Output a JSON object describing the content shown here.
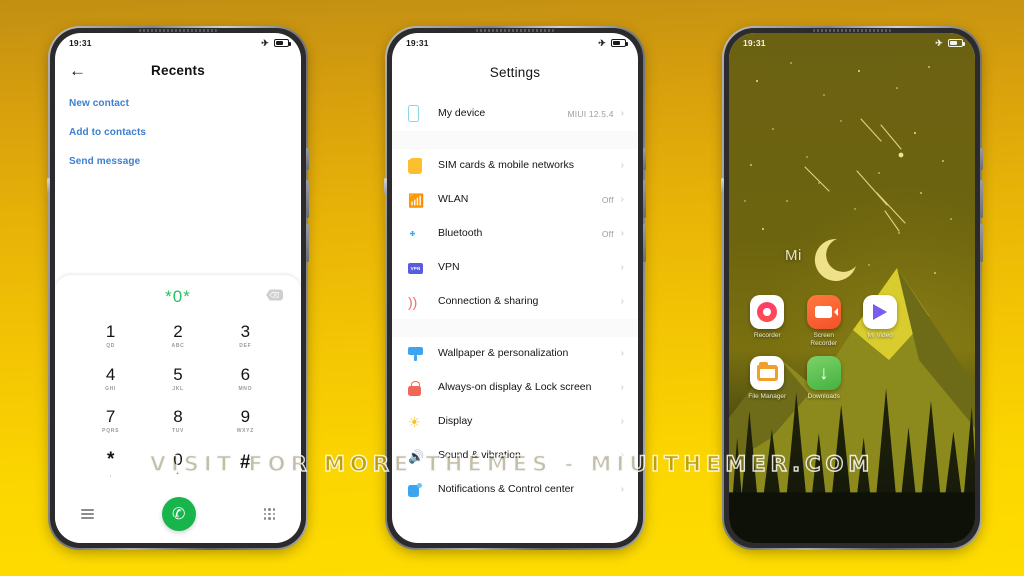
{
  "watermark": "VISIT  FOR  MORE  THEMES  -  MIUITHEMER.COM",
  "status_bar": {
    "time": "19:31",
    "airplane_icon": "airplane-mode-icon",
    "battery_icon": "battery-icon"
  },
  "phone1": {
    "header": {
      "back_icon": "back-arrow-icon",
      "title": "Recents"
    },
    "links": [
      {
        "label": "New contact"
      },
      {
        "label": "Add to contacts"
      },
      {
        "label": "Send message"
      }
    ],
    "dialer": {
      "number": "*0*",
      "backspace_icon": "backspace-icon",
      "keys": [
        {
          "num": "1",
          "sub": "QD"
        },
        {
          "num": "2",
          "sub": "ABC"
        },
        {
          "num": "3",
          "sub": "DEF"
        },
        {
          "num": "4",
          "sub": "GHI"
        },
        {
          "num": "5",
          "sub": "JKL"
        },
        {
          "num": "6",
          "sub": "MNO"
        },
        {
          "num": "7",
          "sub": "PQRS"
        },
        {
          "num": "8",
          "sub": "TUV"
        },
        {
          "num": "9",
          "sub": "WXYZ"
        },
        {
          "num": "*",
          "sub": ","
        },
        {
          "num": "0",
          "sub": "+"
        },
        {
          "num": "#",
          "sub": ""
        }
      ],
      "menu_icon": "hamburger-menu-icon",
      "call_icon": "call-icon",
      "keypad_icon": "keypad-grid-icon",
      "accent_green": "#18b44c",
      "number_color": "#28c160"
    },
    "link_color": "#3c7fd0"
  },
  "phone2": {
    "title": "Settings",
    "group_top": [
      {
        "label": "My device",
        "value": "MIUI 12.5.4",
        "icon": "device-phone-icon"
      }
    ],
    "group_network": [
      {
        "label": "SIM cards & mobile networks",
        "value": "",
        "icon": "sim-card-icon"
      },
      {
        "label": "WLAN",
        "value": "Off",
        "icon": "wifi-icon"
      },
      {
        "label": "Bluetooth",
        "value": "Off",
        "icon": "bluetooth-icon"
      },
      {
        "label": "VPN",
        "value": "",
        "icon": "vpn-icon"
      },
      {
        "label": "Connection & sharing",
        "value": "",
        "icon": "connection-sharing-icon"
      }
    ],
    "group_system": [
      {
        "label": "Wallpaper & personalization",
        "value": "",
        "icon": "wallpaper-icon"
      },
      {
        "label": "Always-on display & Lock screen",
        "value": "",
        "icon": "lock-icon"
      },
      {
        "label": "Display",
        "value": "",
        "icon": "brightness-sun-icon"
      },
      {
        "label": "Sound & vibration",
        "value": "",
        "icon": "sound-icon"
      },
      {
        "label": "Notifications & Control center",
        "value": "",
        "icon": "notifications-icon"
      }
    ],
    "chevron": "›",
    "vpn_badge_text": "VPN"
  },
  "phone3": {
    "widget_text": "Mi",
    "apps": [
      {
        "label": "Recorder",
        "icon": "recorder-app-icon"
      },
      {
        "label": "Screen Recorder",
        "icon": "screen-recorder-app-icon"
      },
      {
        "label": "Mi Video",
        "icon": "mi-video-app-icon"
      },
      {
        "label": "File Manager",
        "icon": "file-manager-app-icon"
      },
      {
        "label": "Downloads",
        "icon": "downloads-app-icon"
      }
    ]
  }
}
